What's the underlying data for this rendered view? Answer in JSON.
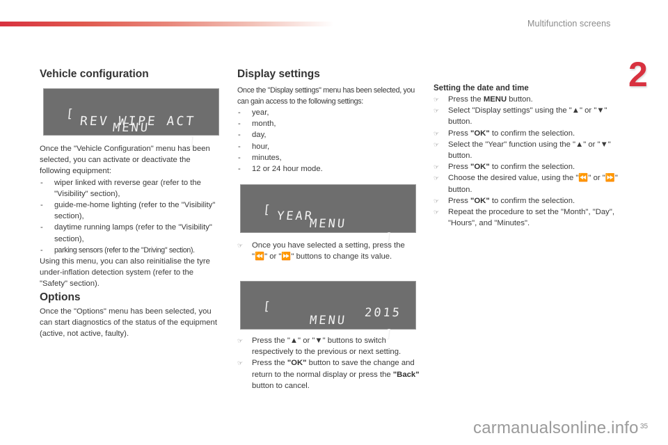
{
  "header": {
    "section_title": "Multifunction screens",
    "chapter_number": "2",
    "accent_color": "#d8313f"
  },
  "vehicle_configuration": {
    "title": "Vehicle configuration",
    "display": {
      "left_bracket": "[",
      "menu_label": "MENU",
      "right_bracket": "]",
      "line2": "REV WIPE ACT"
    },
    "intro": "Once the \"Vehicle Configuration\" menu has been selected, you can activate or deactivate the following equipment:",
    "items": [
      "wiper linked with reverse gear (refer to the \"Visibility\" section),",
      "guide-me-home lighting (refer to the \"Visibility\" section),",
      "daytime running lamps (refer to the \"Visibility\" section),",
      "parking sensors (refer to the \"Driving\" section)."
    ],
    "outro": "Using this menu, you can also reinitialise the tyre under-inflation detection system (refer to the \"Safety\" section)."
  },
  "options": {
    "title": "Options",
    "text": "Once the \"Options\" menu has been selected, you can start diagnostics of the status of the equipment (active, not active, faulty)."
  },
  "display_settings": {
    "title": "Display settings",
    "intro": "Once the \"Display settings\" menu has been selected, you can gain access to the following settings:",
    "items": [
      "year,",
      "month,",
      "day,",
      "hour,",
      "minutes,",
      "12 or 24 hour mode."
    ],
    "display_year": {
      "left_bracket": "[",
      "menu_label": "MENU",
      "right_bracket": "]",
      "line2": "YEAR"
    },
    "step_change_value": "Once you have selected a setting, press the \"⏪\" or \"⏩\" buttons to change its value.",
    "display_value": {
      "left_bracket": "[",
      "menu_label": "MENU",
      "right_bracket": "]",
      "line2": "2015"
    },
    "steps_after": [
      {
        "pre": "Press the \"▲\" or \"▼\" buttons to switch respectively to the previous or next setting.",
        "bold": "",
        "post": ""
      },
      {
        "pre": "Press the ",
        "bold": "\"OK\"",
        "post": " button to save the change and return to the normal display or press the ",
        "bold2": "\"Back\"",
        "post2": " button to cancel."
      }
    ]
  },
  "setting_date_time": {
    "title": "Setting the date and time",
    "bullet_icon": "☞",
    "steps": [
      {
        "pre": "Press the ",
        "bold": "MENU",
        "post": " button."
      },
      {
        "pre": "Select \"Display settings\" using the \"▲\" or \"▼\" button.",
        "bold": "",
        "post": ""
      },
      {
        "pre": "Press ",
        "bold": "\"OK\"",
        "post": " to confirm the selection."
      },
      {
        "pre": "Select the \"Year\" function using the \"▲\" or \"▼\" button.",
        "bold": "",
        "post": ""
      },
      {
        "pre": "Press ",
        "bold": "\"OK\"",
        "post": " to confirm the selection."
      },
      {
        "pre": "Choose the desired value, using the \"⏪\" or \"⏩\" button.",
        "bold": "",
        "post": ""
      },
      {
        "pre": "Press ",
        "bold": "\"OK\"",
        "post": " to confirm the selection."
      },
      {
        "pre": "Repeat the procedure to set the \"Month\", \"Day\", \"Hours\", and \"Minutes\".",
        "bold": "",
        "post": ""
      }
    ]
  },
  "footer": {
    "page_number": "35",
    "watermark": "carmanualsonline.info"
  }
}
